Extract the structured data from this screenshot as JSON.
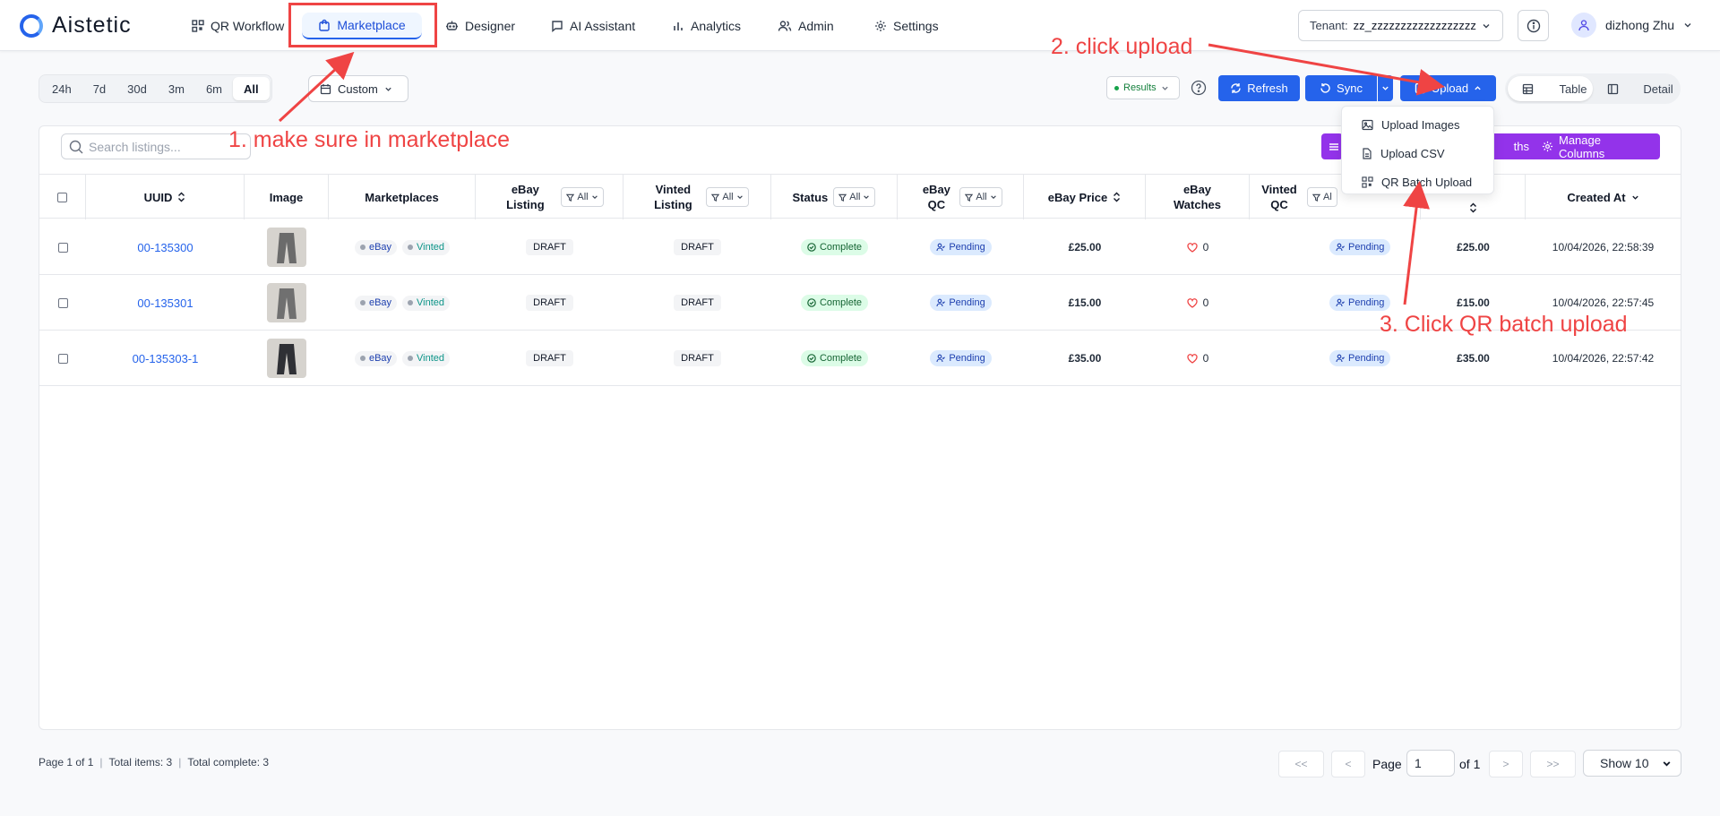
{
  "app": {
    "name": "Aistetic"
  },
  "nav": [
    {
      "label": "QR Workflow",
      "icon": "qr-icon"
    },
    {
      "label": "Marketplace",
      "icon": "bag-icon",
      "active": true
    },
    {
      "label": "Designer",
      "icon": "robot-icon"
    },
    {
      "label": "AI Assistant",
      "icon": "chat-icon"
    },
    {
      "label": "Analytics",
      "icon": "bar-chart-icon"
    },
    {
      "label": "Admin",
      "icon": "users-icon"
    },
    {
      "label": "Settings",
      "icon": "gear-icon"
    }
  ],
  "tenant": {
    "label": "Tenant:",
    "value": "zz_zzzzzzzzzzzzzzzzzz"
  },
  "user": {
    "name": "dizhong Zhu"
  },
  "time_ranges": [
    "24h",
    "7d",
    "30d",
    "3m",
    "6m",
    "All"
  ],
  "time_range_selected": "All",
  "custom_label": "Custom",
  "toolbar": {
    "results_label": "Results",
    "refresh_label": "Refresh",
    "sync_label": "Sync",
    "upload_label": "Upload",
    "table_label": "Table",
    "detail_label": "Detail"
  },
  "upload_menu": [
    "Upload Images",
    "Upload CSV",
    "QR Batch Upload"
  ],
  "search": {
    "placeholder": "Search listings..."
  },
  "action_buttons": {
    "widths_label": "ths",
    "manage_columns_label": "Manage Columns"
  },
  "columns": {
    "uuid": "UUID",
    "image": "Image",
    "marketplaces": "Marketplaces",
    "ebay_listing_1": "eBay",
    "ebay_listing_2": "Listing",
    "vinted_listing_1": "Vinted",
    "vinted_listing_2": "Listing",
    "status": "Status",
    "ebay_qc_1": "eBay",
    "ebay_qc_2": "QC",
    "ebay_price": "eBay Price",
    "ebay_watches_1": "eBay",
    "ebay_watches_2": "Watches",
    "vinted_qc_1": "Vinted",
    "vinted_qc_2": "QC",
    "created_at": "Created At",
    "filter_all": "All",
    "filter_partial": "Al"
  },
  "rows": [
    {
      "uuid": "00-135300",
      "ebay_listing": "DRAFT",
      "vinted_listing": "DRAFT",
      "status": "Complete",
      "ebay_qc": "Pending",
      "ebay_price": "£25.00",
      "watches": "0",
      "vinted_qc": "Pending",
      "vinted_price": "£25.00",
      "created_at": "10/04/2026, 22:58:39"
    },
    {
      "uuid": "00-135301",
      "ebay_listing": "DRAFT",
      "vinted_listing": "DRAFT",
      "status": "Complete",
      "ebay_qc": "Pending",
      "ebay_price": "£15.00",
      "watches": "0",
      "vinted_qc": "Pending",
      "vinted_price": "£15.00",
      "created_at": "10/04/2026, 22:57:45"
    },
    {
      "uuid": "00-135303-1",
      "ebay_listing": "DRAFT",
      "vinted_listing": "DRAFT",
      "status": "Complete",
      "ebay_qc": "Pending",
      "ebay_price": "£35.00",
      "watches": "0",
      "vinted_qc": "Pending",
      "vinted_price": "£35.00",
      "created_at": "10/04/2026, 22:57:42"
    }
  ],
  "marketplace_tags": {
    "ebay": "eBay",
    "vinted": "Vinted"
  },
  "footer": {
    "page_info": "Page 1 of 1",
    "total_items": "Total items: 3",
    "total_complete": "Total complete: 3",
    "sep": "|",
    "first": "<<",
    "prev": "<",
    "page_label": "Page",
    "page_value": "1",
    "of_label": "of 1",
    "next": ">",
    "last": ">>",
    "show_label": "Show 10"
  },
  "annotations": {
    "step1": "1. make sure in marketplace",
    "step2": "2. click upload",
    "step3": "3. Click QR batch upload"
  },
  "colors": {
    "accent": "#2563eb",
    "purple": "#9333ea",
    "annotation": "#ef4444"
  }
}
